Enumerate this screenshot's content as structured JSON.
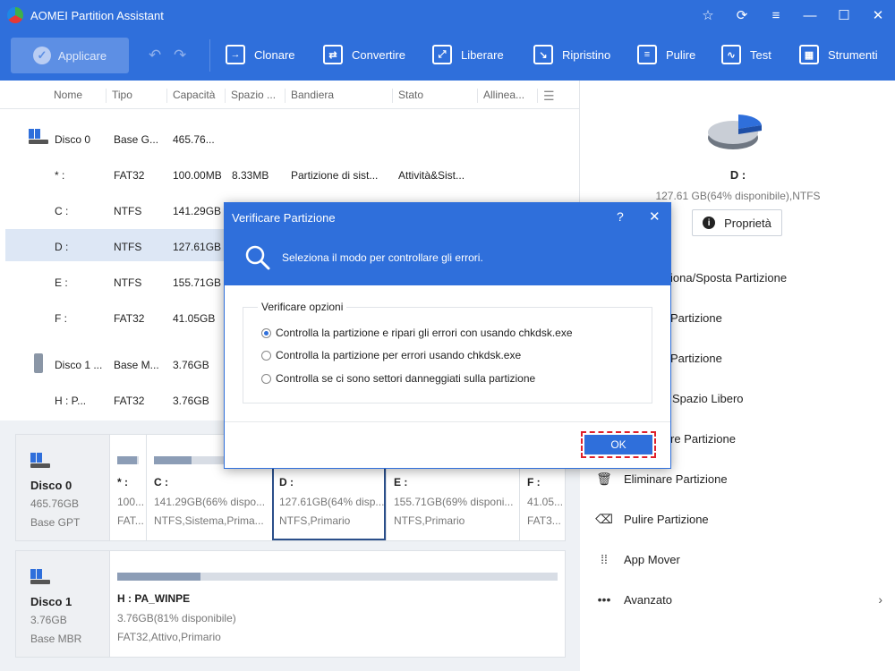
{
  "app": {
    "title": "AOMEI Partition Assistant"
  },
  "window_controls": {
    "star": "☆",
    "refresh": "⟳",
    "menu": "≡",
    "minimize": "—",
    "maximize": "☐",
    "close": "✕"
  },
  "toolbar": {
    "apply_label": "Applicare",
    "items": [
      {
        "label": "Clonare",
        "icon": "clone-icon"
      },
      {
        "label": "Convertire",
        "icon": "convert-icon"
      },
      {
        "label": "Liberare",
        "icon": "free-up-icon"
      },
      {
        "label": "Ripristino",
        "icon": "recovery-icon"
      },
      {
        "label": "Pulire",
        "icon": "wipe-icon"
      },
      {
        "label": "Test",
        "icon": "test-icon"
      },
      {
        "label": "Strumenti",
        "icon": "tools-icon"
      }
    ]
  },
  "table": {
    "headers": [
      "Nome",
      "Tipo",
      "Capacità",
      "Spazio ...",
      "Bandiera",
      "Stato",
      "Allinea..."
    ],
    "rows": [
      {
        "name": "Disco 0",
        "type": "Base G...",
        "capacity": "465.76...",
        "space": "",
        "flag": "",
        "status": ""
      },
      {
        "name": "* :",
        "type": "FAT32",
        "capacity": "100.00MB",
        "space": "8.33MB",
        "flag": "Partizione di sist...",
        "status": "Attività&Sist..."
      },
      {
        "name": "C :",
        "type": "NTFS",
        "capacity": "141.29GB",
        "space": "",
        "flag": "",
        "status": ""
      },
      {
        "name": "D :",
        "type": "NTFS",
        "capacity": "127.61GB",
        "space": "",
        "flag": "",
        "status": ""
      },
      {
        "name": "E :",
        "type": "NTFS",
        "capacity": "155.71GB",
        "space": "",
        "flag": "",
        "status": ""
      },
      {
        "name": "F :",
        "type": "FAT32",
        "capacity": "41.05GB",
        "space": "",
        "flag": "",
        "status": ""
      },
      {
        "name": "Disco 1 ...",
        "type": "Base M...",
        "capacity": "3.76GB",
        "space": "",
        "flag": "",
        "status": ""
      },
      {
        "name": "H : P...",
        "type": "FAT32",
        "capacity": "3.76GB",
        "space": "",
        "flag": "",
        "status": ""
      }
    ]
  },
  "diskmap": {
    "disk0": {
      "name": "Disco 0",
      "size": "465.76GB",
      "style": "Base GPT",
      "partitions": [
        {
          "name": "* :",
          "detail1": "100...",
          "detail2": "FAT...",
          "used": 0.9
        },
        {
          "name": "C :",
          "detail1": "141.29GB(66% dispo...",
          "detail2": "NTFS,Sistema,Prima...",
          "used": 0.34
        },
        {
          "name": "D :",
          "detail1": "127.61GB(64% disp...",
          "detail2": "NTFS,Primario",
          "used": 0.36
        },
        {
          "name": "E :",
          "detail1": "155.71GB(69% disponi...",
          "detail2": "NTFS,Primario",
          "used": 0.31
        },
        {
          "name": "F :",
          "detail1": "41.05...",
          "detail2": "FAT3...",
          "used": 0.3
        }
      ]
    },
    "disk1": {
      "name": "Disco 1",
      "size": "3.76GB",
      "style": "Base MBR",
      "partitions": [
        {
          "name": "H : PA_WINPE",
          "detail1": "3.76GB(81% disponibile)",
          "detail2": "FAT32,Attivo,Primario",
          "used": 0.19
        }
      ]
    }
  },
  "right_pane": {
    "drive_label": "D :",
    "drive_info": "127.61 GB(64% disponibile),NTFS",
    "properties_label": "Proprietà",
    "operations": [
      "Ridimensiona/Sposta Partizione",
      "Unire Partizione",
      "Dividere Partizione",
      "Allocare Spazio Libero",
      "Copiare Partizione",
      "Eliminare Partizione",
      "Pulire Partizione",
      "App Mover",
      "Avanzato"
    ],
    "visible_operations": [
      "iona/Sposta Partizione",
      "Partizione",
      "Partizione",
      "Spazio Libero",
      "re Partizione",
      "Eliminare Partizione",
      "Pulire Partizione",
      "App Mover",
      "Avanzato"
    ]
  },
  "dialog": {
    "title": "Verificare Partizione",
    "help": "?",
    "close": "✕",
    "subtitle": "Seleziona il modo per controllare gli errori.",
    "group_label": "Verificare opzioni",
    "options": [
      {
        "label": "Controlla la partizione e ripari gli errori con usando chkdsk.exe",
        "selected": true
      },
      {
        "label": "Controlla la partizione per errori usando chkdsk.exe",
        "selected": false
      },
      {
        "label": "Controlla se ci sono settori danneggiati sulla partizione",
        "selected": false
      }
    ],
    "ok_label": "OK"
  },
  "colors": {
    "brand_blue": "#2f6fdb",
    "highlight_red": "#e0202a",
    "selected_row": "#dde7f5"
  }
}
